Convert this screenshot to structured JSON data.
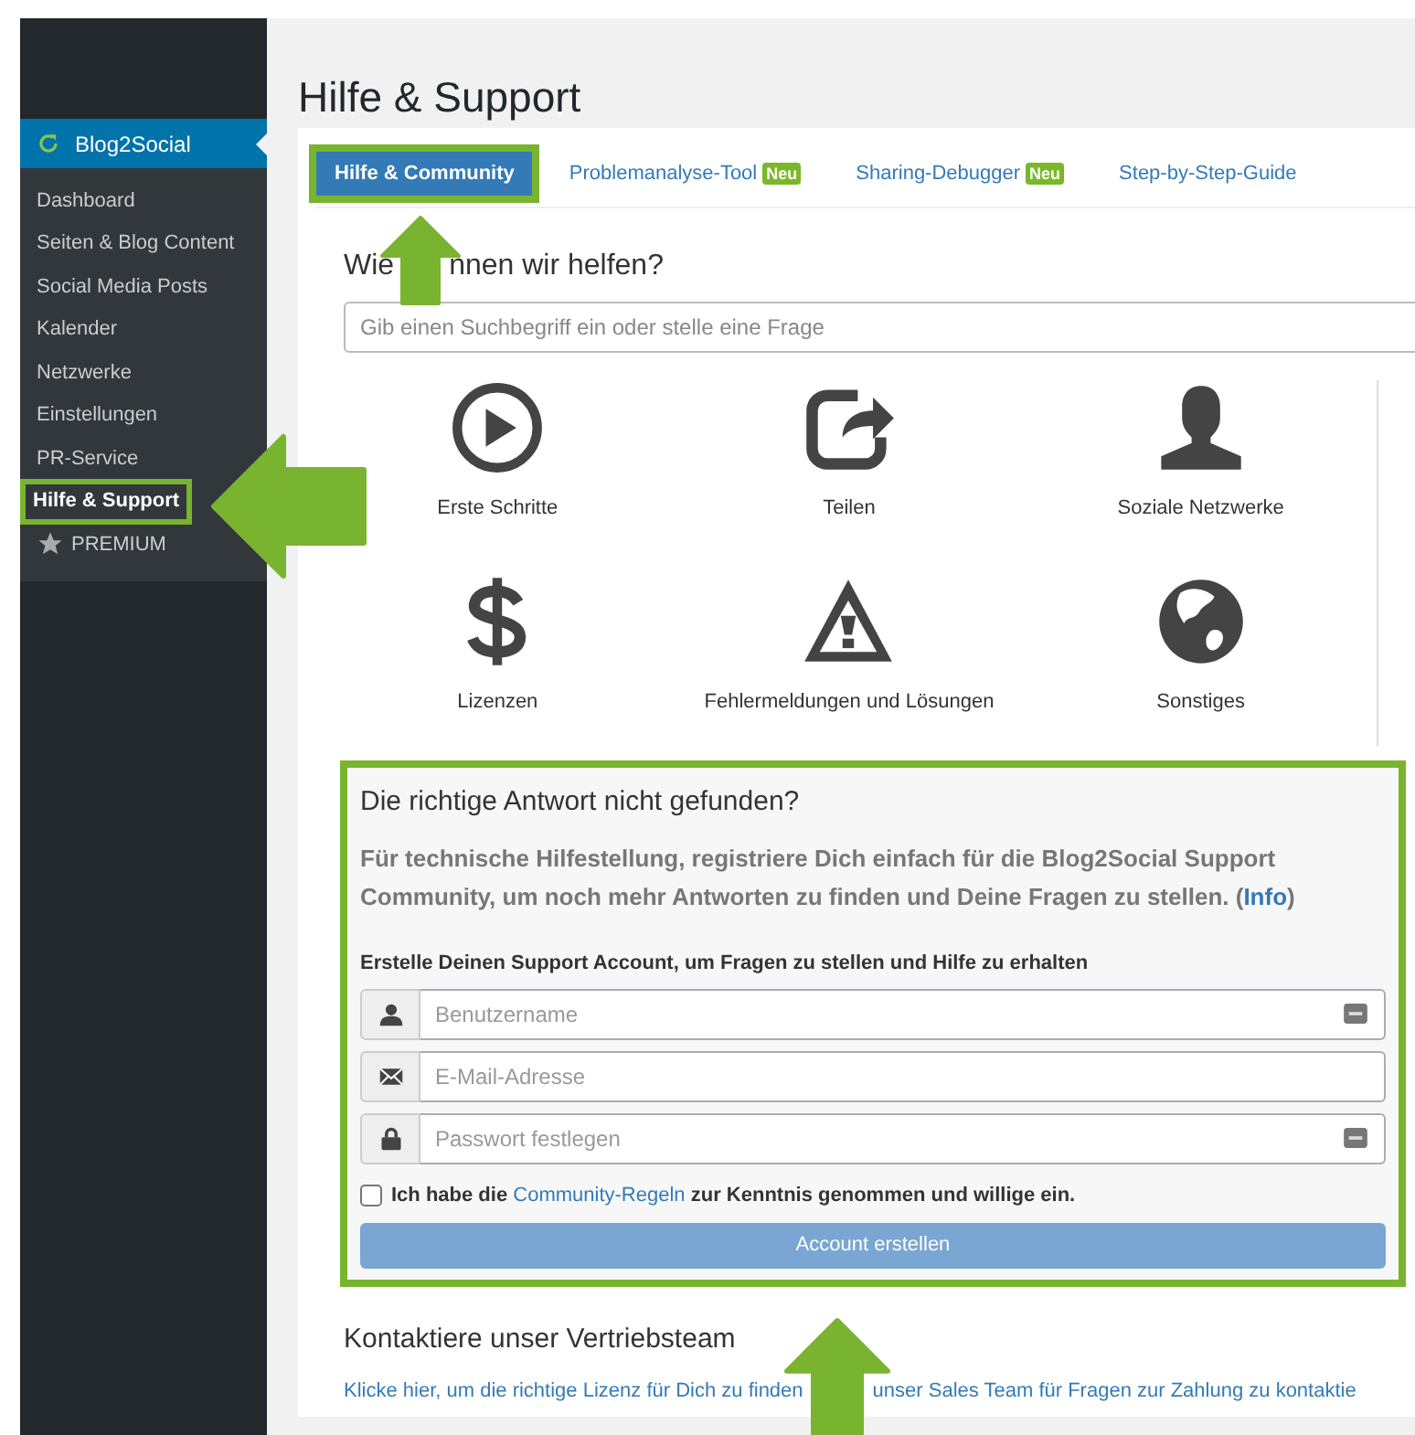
{
  "sidebar": {
    "plugin": {
      "label": "Blog2Social",
      "selected": true
    },
    "items": [
      {
        "label": "Dashboard",
        "kind": "link",
        "selected": false,
        "highlighted": false
      },
      {
        "label": "Seiten & Blog Content",
        "kind": "link",
        "selected": false,
        "highlighted": false
      },
      {
        "label": "Social Media Posts",
        "kind": "link",
        "selected": false,
        "highlighted": false
      },
      {
        "label": "Kalender",
        "kind": "link",
        "selected": false,
        "highlighted": false
      },
      {
        "label": "Netzwerke",
        "kind": "link",
        "selected": false,
        "highlighted": false
      },
      {
        "label": "Einstellungen",
        "kind": "link",
        "selected": false,
        "highlighted": false
      },
      {
        "label": "PR-Service",
        "kind": "link",
        "selected": false,
        "highlighted": false
      },
      {
        "label": "Hilfe & Support",
        "kind": "link",
        "selected": true,
        "highlighted": true
      },
      {
        "label": "PREMIUM",
        "kind": "premium",
        "selected": false,
        "highlighted": false
      }
    ]
  },
  "page_title": "Hilfe & Support",
  "tabs": [
    {
      "label": "Hilfe & Community",
      "selected": true,
      "highlighted": true
    },
    {
      "label": "Problemanalyse-Tool",
      "badge": "Neu",
      "selected": false,
      "highlighted": false
    },
    {
      "label": "Sharing-Debugger",
      "badge": "Neu",
      "selected": false,
      "highlighted": false
    },
    {
      "label": "Step-by-Step-Guide",
      "selected": false,
      "highlighted": false
    }
  ],
  "help": {
    "heading_parts": [
      "Wie",
      "nnen wir helfen?"
    ],
    "search": {
      "placeholder": "Gib einen Suchbegriff ein oder stelle eine Frage"
    }
  },
  "categories": [
    {
      "label": "Erste Schritte",
      "kind": "play"
    },
    {
      "label": "Teilen",
      "kind": "share"
    },
    {
      "label": "Soziale Netzwerke",
      "kind": "person"
    },
    {
      "label": "Lizenzen",
      "kind": "dollar"
    },
    {
      "label": "Fehlermeldungen und Lösungen",
      "kind": "warning"
    },
    {
      "label": "Sonstiges",
      "kind": "globe"
    }
  ],
  "community": {
    "highlighted": true,
    "title": "Die richtige Antwort nicht gefunden?",
    "text_before": "Für technische Hilfestellung, registriere Dich einfach für die Blog2Social Support Community, um noch mehr Antworten zu finden und Deine Fragen zu stellen. (",
    "link": "Info",
    "text_after": ")",
    "form_label": "Erstelle Deinen Support Account, um Fragen zu stellen und Hilfe zu erhalten",
    "fields": [
      {
        "kind": "user",
        "placeholder": "Benutzername",
        "key_icon": true
      },
      {
        "kind": "email",
        "placeholder": "E-Mail-Adresse",
        "key_icon": false
      },
      {
        "kind": "password",
        "placeholder": "Passwort festlegen",
        "key_icon": true
      }
    ],
    "consent": {
      "checked": false,
      "text_before": "Ich habe die",
      "link": "Community-Regeln",
      "text_after": "zur Kenntnis genommen und willige ein."
    },
    "button": {
      "label": "Account erstellen",
      "disabled": true
    }
  },
  "sales": {
    "title": "Kontaktiere unser Vertriebsteam",
    "link_parts": [
      "Klicke hier, um die richtige Lizenz für Dich zu finden",
      "unser Sales Team für Fragen zur Zahlung zu kontaktie"
    ]
  }
}
